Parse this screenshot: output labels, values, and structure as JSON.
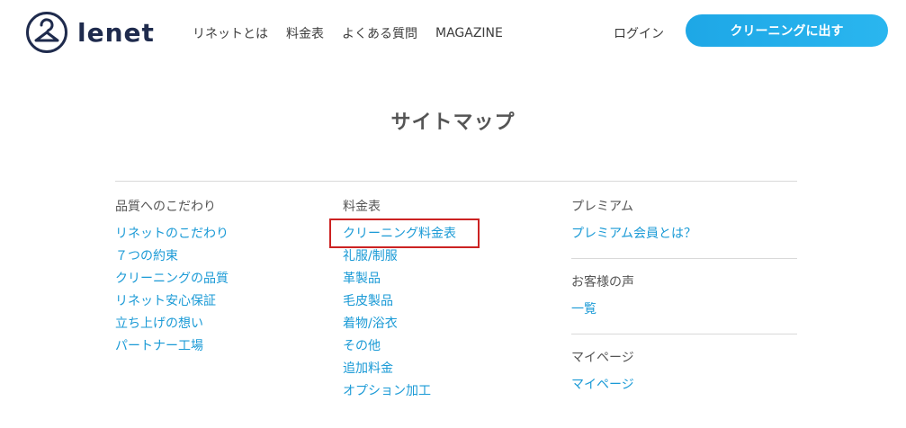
{
  "brand": {
    "name": "lenet"
  },
  "nav": {
    "items": [
      "リネットとは",
      "料金表",
      "よくある質問",
      "MAGAZINE"
    ],
    "login": "ログイン",
    "cta": "クリーニングに出す"
  },
  "page": {
    "title": "サイトマップ"
  },
  "sections": {
    "quality": {
      "title": "品質へのこだわり",
      "links": [
        "リネットのこだわり",
        "７つの約束",
        "クリーニングの品質",
        "リネット安心保証",
        "立ち上げの想い",
        "パートナー工場"
      ]
    },
    "price": {
      "title": "料金表",
      "links": [
        "クリーニング料金表",
        "礼服/制服",
        "革製品",
        "毛皮製品",
        "着物/浴衣",
        "その他",
        "追加料金",
        "オプション加工"
      ]
    },
    "premium": {
      "title": "プレミアム",
      "links": [
        "プレミアム会員とは？"
      ]
    },
    "voice": {
      "title": "お客様の声",
      "links": [
        "一覧"
      ]
    },
    "mypage": {
      "title": "マイページ",
      "links": [
        "マイページ"
      ]
    }
  },
  "colors": {
    "accent": "#1a9ad6",
    "brand": "#1f2b4d",
    "highlight": "#cc2222"
  }
}
